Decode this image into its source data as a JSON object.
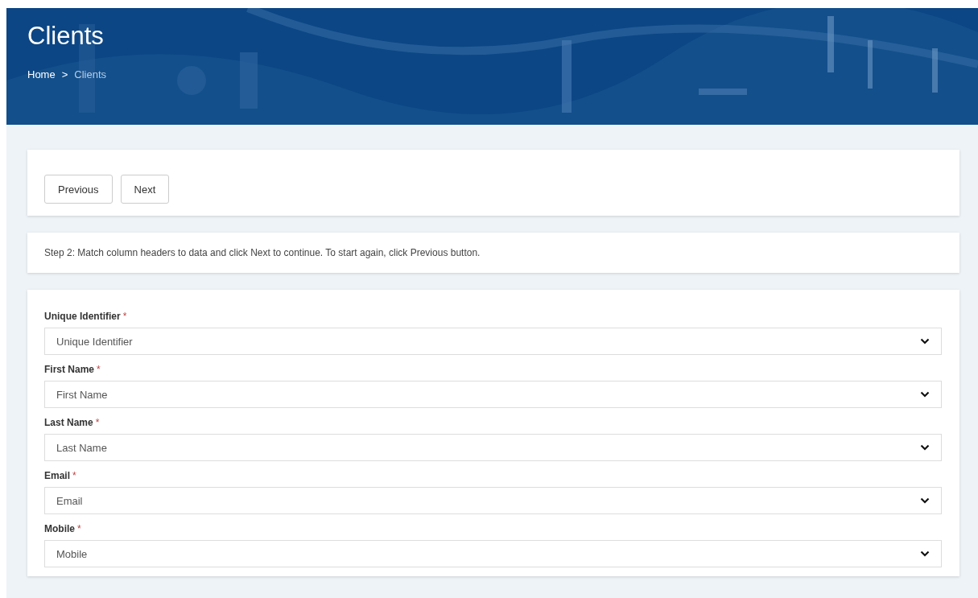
{
  "header": {
    "title": "Clients",
    "breadcrumb": [
      {
        "label": "Home",
        "current": false
      },
      {
        "label": "Clients",
        "current": true
      }
    ],
    "separator": ">"
  },
  "nav_buttons": [
    "Previous",
    "Next"
  ],
  "instruction": "Step 2: Match column headers to data and click Next to continue. To start again, click Previous button.",
  "fields": [
    {
      "label": "Unique Identifier",
      "required_mark": "*",
      "value": "Unique Identifier"
    },
    {
      "label": "First Name",
      "required_mark": "*",
      "value": "First Name"
    },
    {
      "label": "Last Name",
      "required_mark": "*",
      "value": "Last Name"
    },
    {
      "label": "Email",
      "required_mark": "*",
      "value": "Email"
    },
    {
      "label": "Mobile",
      "required_mark": "*",
      "value": "Mobile"
    }
  ]
}
